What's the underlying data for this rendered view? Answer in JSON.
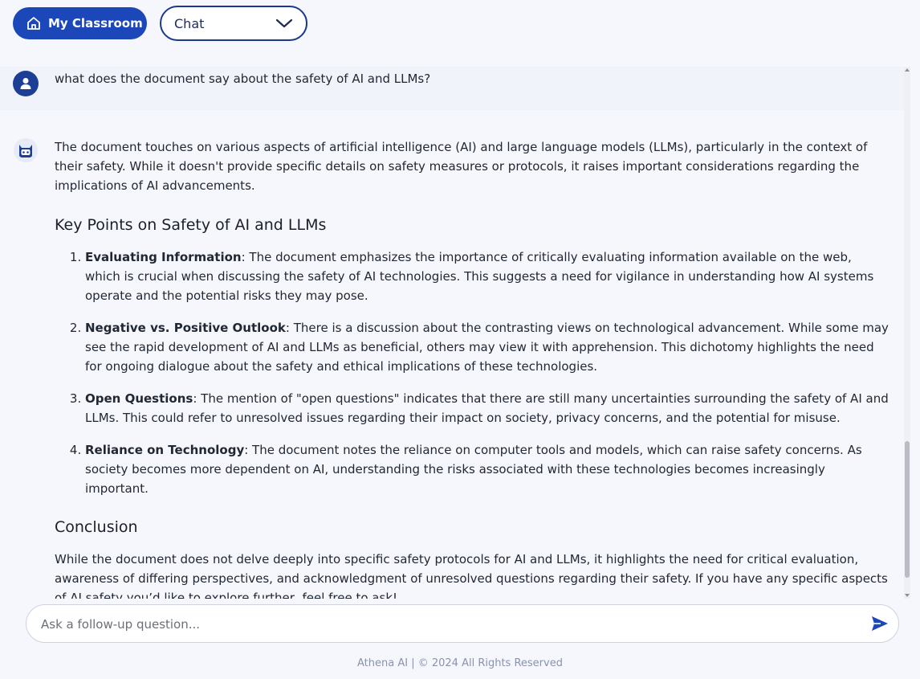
{
  "header": {
    "classroom_label": "My Classroom",
    "mode_selected": "Chat"
  },
  "chat": {
    "user_message": "what does the document say about the safety of AI and LLMs?",
    "bot": {
      "intro": "The document touches on various aspects of artificial intelligence (AI) and large language models (LLMs), particularly in the context of their safety. While it doesn't provide specific details on safety measures or protocols, it raises important considerations regarding the implications of AI advancements.",
      "heading_key_points": "Key Points on Safety of AI and LLMs",
      "points": [
        {
          "title": "Evaluating Information",
          "text": ": The document emphasizes the importance of critically evaluating information available on the web, which is crucial when discussing the safety of AI technologies. This suggests a need for vigilance in understanding how AI systems operate and the potential risks they may pose."
        },
        {
          "title": "Negative vs. Positive Outlook",
          "text": ": There is a discussion about the contrasting views on technological advancement. While some may see the rapid development of AI and LLMs as beneficial, others may view it with apprehension. This dichotomy highlights the need for ongoing dialogue about the safety and ethical implications of these technologies."
        },
        {
          "title": "Open Questions",
          "text": ": The mention of \"open questions\" indicates that there are still many uncertainties surrounding the safety of AI and LLMs. This could refer to unresolved issues regarding their impact on society, privacy concerns, and the potential for misuse."
        },
        {
          "title": "Reliance on Technology",
          "text": ": The document notes the reliance on computer tools and models, which can raise safety concerns. As society becomes more dependent on AI, understanding the risks associated with these technologies becomes increasingly important."
        }
      ],
      "heading_conclusion": "Conclusion",
      "conclusion": "While the document does not delve deeply into specific safety protocols for AI and LLMs, it highlights the need for critical evaluation, awareness of differing perspectives, and acknowledgment of unresolved questions regarding their safety. If you have any specific aspects of AI safety you’d like to explore further, feel free to ask!"
    }
  },
  "input": {
    "placeholder": "Ask a follow-up question..."
  },
  "footer": {
    "text": "Athena AI | © 2024 All Rights Reserved"
  },
  "icons": {
    "classroom": "home-icon",
    "mode_dropdown": "chevron-down-icon",
    "user_avatar": "user-icon",
    "bot_avatar": "robot-icon",
    "send": "send-icon"
  },
  "colors": {
    "primary": "#1b47b8",
    "dropdown_border": "#1b3a8f",
    "user_avatar": "#1c3f95",
    "background": "#f5f7fd",
    "footer_text": "#8a93aa"
  }
}
